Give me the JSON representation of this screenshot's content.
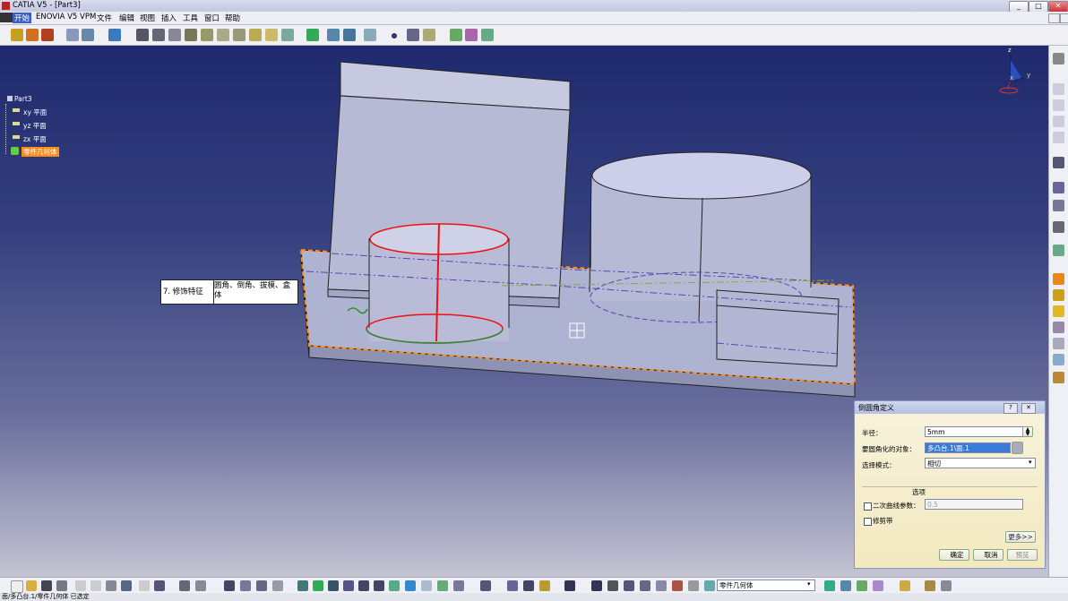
{
  "window": {
    "title": "CATIA V5 - [Part3]"
  },
  "window_controls": {
    "min": "_",
    "max": "□",
    "close": "✕"
  },
  "menu": [
    "开始",
    "ENOVIA V5 VPM",
    "文件",
    "编辑",
    "视图",
    "插入",
    "工具",
    "窗口",
    "帮助"
  ],
  "tree": {
    "root": "Part3",
    "items": [
      "xy 平面",
      "yz 平面",
      "zx 平面",
      "零件几何体"
    ]
  },
  "callout": {
    "label": "7. 修饰特征",
    "text": "圆角、倒角、拔模、盒体"
  },
  "compass": {
    "x": "x",
    "y": "y",
    "z": "z"
  },
  "dialog": {
    "title": "倒圆角定义",
    "help": "?",
    "close": "✕",
    "radius_label": "半径：",
    "radius_value": "5mm",
    "objects_label": "要圆角化的对象：",
    "objects_value": "多凸台.1\\面.1",
    "mode_label": "选择模式：",
    "mode_value": "相切",
    "options_label": "选项",
    "conic_label": "二次曲线参数：",
    "conic_value": "0.5",
    "trim_label": "修剪带",
    "more_label": "更多>>",
    "ok_label": "确定",
    "cancel_label": "取消",
    "preview_label": "预览"
  },
  "bottom": {
    "body_select": "零件几何体"
  },
  "status": "面/多凸台.1/零件几何体 已选定"
}
